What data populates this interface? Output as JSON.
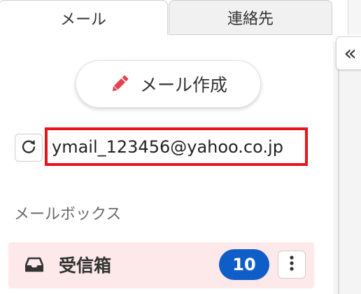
{
  "tabs": {
    "mail_label": "メール",
    "contacts_label": "連絡先"
  },
  "rail": {
    "collapse_glyph": "«"
  },
  "compose": {
    "label": "メール作成",
    "icon": "pencil-icon",
    "icon_color": "#e04452"
  },
  "account": {
    "email": "ymail_123456@yahoo.co.jp",
    "refresh_icon": "refresh-icon",
    "highlight_color": "#e8141b"
  },
  "mailbox": {
    "heading": "メールボックス",
    "items": [
      {
        "label": "受信箱",
        "icon": "inbox-tray-icon",
        "unread_count": "10",
        "badge_color": "#0f5ec7",
        "row_color": "#fde9ea",
        "menu_icon": "more-vertical-icon"
      }
    ]
  }
}
